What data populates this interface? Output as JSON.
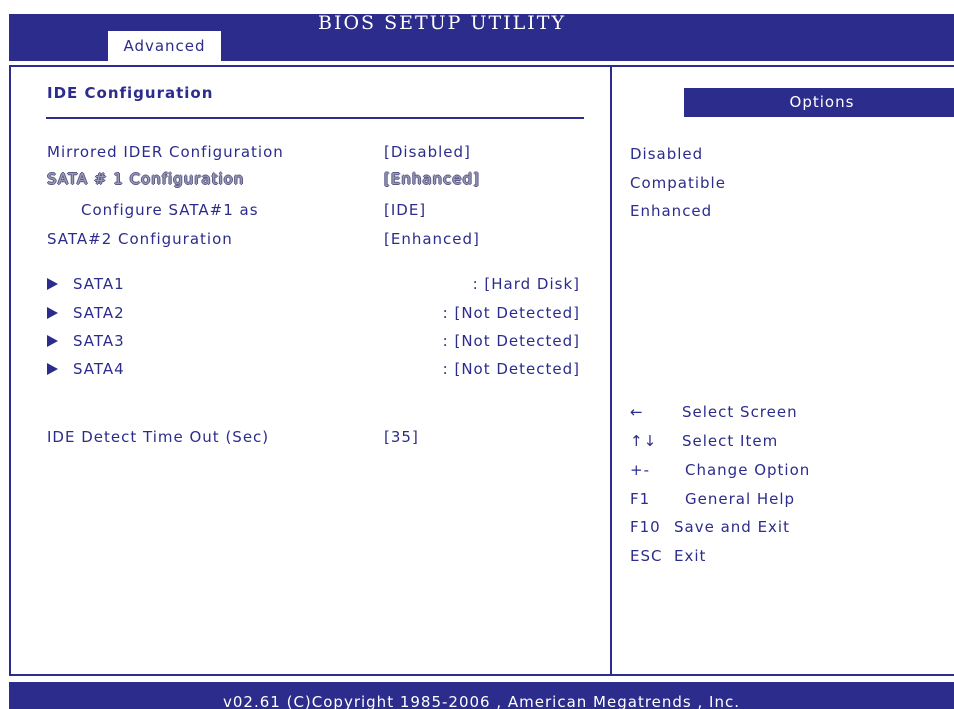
{
  "app": {
    "title": "BIOS SETUP UTILITY"
  },
  "tabs": [
    {
      "label": "Advanced",
      "active": true
    }
  ],
  "section": {
    "title": "IDE Configuration"
  },
  "settings": [
    {
      "label": "Mirrored IDER Configuration",
      "value": "[Disabled]"
    },
    {
      "label": "SATA # 1  Configuration",
      "value": "[Enhanced]",
      "selected": true
    },
    {
      "label": "Configure SATA#1  as",
      "value": "[IDE]"
    },
    {
      "label": "SATA#2 Configuration",
      "value": "[Enhanced]"
    }
  ],
  "drives": [
    {
      "label": "SATA1",
      "value": ": [Hard Disk]",
      "icon": "triangle-right-icon"
    },
    {
      "label": "SATA2",
      "value": ": [Not Detected]",
      "icon": "triangle-right-icon"
    },
    {
      "label": "SATA3",
      "value": ": [Not Detected]",
      "icon": "triangle-right-icon"
    },
    {
      "label": "SATA4",
      "value": ": [Not Detected]",
      "icon": "triangle-right-icon"
    }
  ],
  "timeout": {
    "label": "IDE Detect Time Out  (Sec)",
    "value": "[35]"
  },
  "options_panel": {
    "header": "Options",
    "items": [
      "Disabled",
      "Compatible",
      "Enhanced"
    ]
  },
  "help": [
    {
      "key": "←",
      "desc": "Select Screen"
    },
    {
      "key": "↑↓",
      "desc": "Select Item"
    },
    {
      "key": "+-",
      "desc": "Change Option"
    },
    {
      "key": "F1",
      "desc": "General Help"
    },
    {
      "key": "F10",
      "desc": "Save and Exit"
    },
    {
      "key": "ESC",
      "desc": "Exit"
    }
  ],
  "footer": {
    "text": "v02.61  (C)Copyright 1985-2006 , American Megatrends , Inc."
  },
  "colors": {
    "primary": "#2c2c8c",
    "background": "#ffffff",
    "highlight_fill": "#9a9ab6"
  }
}
